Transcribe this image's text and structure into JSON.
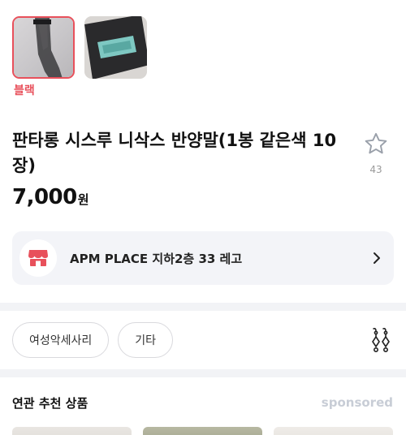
{
  "variant": {
    "selected_label": "블랙"
  },
  "product": {
    "title": "판타롱 시스루 니삭스 반양말(1봉 같은색 10장)",
    "price": "7,000",
    "price_unit": "원",
    "wish_count": "43"
  },
  "store": {
    "name": "APM PLACE 지하2층 33 레고"
  },
  "tags": [
    "여성악세사리",
    "기타"
  ],
  "recommend": {
    "title": "연관 추천 상품",
    "sponsored": "sponsored"
  },
  "icons": {
    "store": "store-awning-icon",
    "arrow": "chevron-right-icon",
    "wish": "star-outline-icon",
    "share": "earring-icon"
  },
  "colors": {
    "accent": "#e8505b",
    "store_icon": "#e8505b",
    "sponsored": "#c8cdd6"
  }
}
